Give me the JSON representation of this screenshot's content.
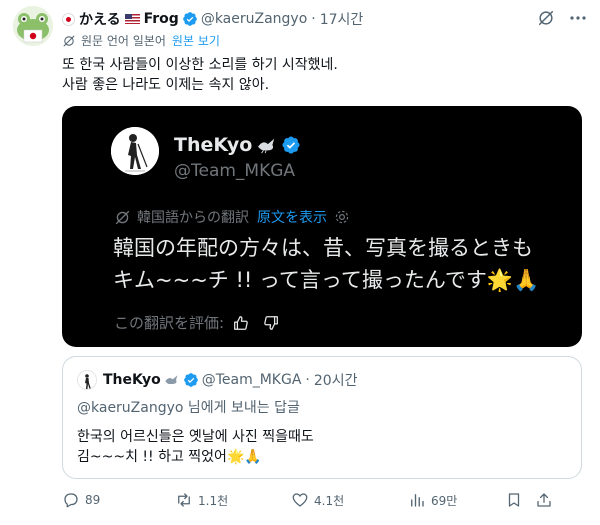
{
  "tweet": {
    "author_name": "かえる",
    "author_name_suffix": "Frog",
    "handle": "@kaeruZangyo",
    "dot": "·",
    "time": "17시간",
    "translation_note": "원문 언어 일본어",
    "show_original": "원본 보기",
    "text_line1": "또 한국 사람들이 이상한 소리를 하기 시작했네.",
    "text_line2": "사람 좋은 나라도 이제는 속지 않아."
  },
  "media": {
    "name": "TheKyo",
    "handle": "@Team_MKGA",
    "translation_note": "韓国語からの翻訳",
    "show_original": "原文を表示",
    "text_line1": "韓国の年配の方々は、昔、写真を撮るときも",
    "text_line2": "キム~~~チ !! って言って撮ったんです",
    "emoji": "🌟🙏",
    "rate_label": "この翻訳を評価:"
  },
  "quote": {
    "name": "TheKyo",
    "handle": "@Team_MKGA",
    "dot": "·",
    "time": "20시간",
    "reply_to": "@kaeruZangyo 님에게 보내는 답글",
    "text_line1": "한국의 어르신들은 옛날에 사진 찍을때도",
    "text_line2": "김~~~치 !! 하고 찍었어",
    "emoji": "🌟🙏"
  },
  "actions": {
    "replies": "89",
    "reposts": "1.1천",
    "likes": "4.1천",
    "views": "69만"
  },
  "colors": {
    "accent": "#1d9bf0",
    "text": "#0f1419",
    "muted": "#536471",
    "media_bg": "#000000"
  }
}
